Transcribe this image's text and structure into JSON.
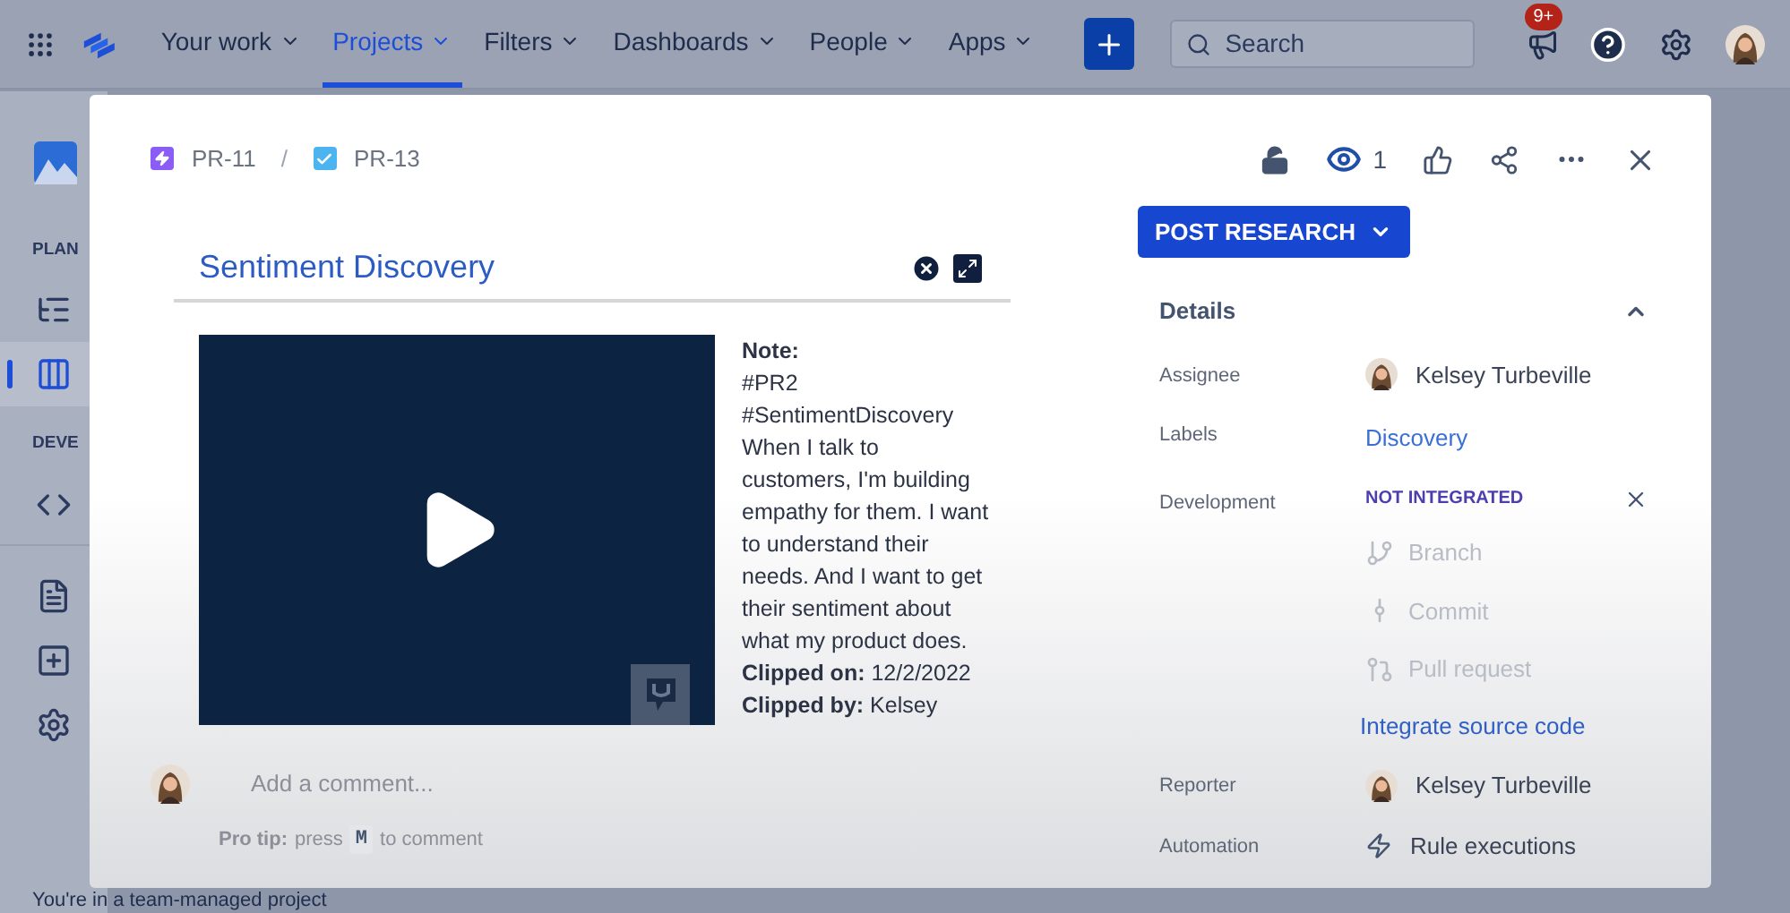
{
  "nav": {
    "items": [
      {
        "label": "Your work",
        "selected": false
      },
      {
        "label": "Projects",
        "selected": true
      },
      {
        "label": "Filters",
        "selected": false
      },
      {
        "label": "Dashboards",
        "selected": false
      },
      {
        "label": "People",
        "selected": false
      },
      {
        "label": "Apps",
        "selected": false
      }
    ],
    "search": {
      "placeholder": "Search"
    },
    "notification_badge": "9+"
  },
  "sidebar": {
    "sections": [
      {
        "label": "PLAN",
        "items": [
          {
            "kind": "roadmap",
            "selected": false
          },
          {
            "kind": "board",
            "selected": true
          }
        ]
      },
      {
        "label": "DEVE",
        "items": [
          {
            "kind": "code",
            "selected": false
          }
        ]
      },
      {
        "items": [
          {
            "kind": "page",
            "selected": false
          },
          {
            "kind": "add",
            "selected": false
          },
          {
            "kind": "settings",
            "selected": false
          }
        ]
      }
    ],
    "footer": "You're in a team-managed project"
  },
  "modal": {
    "breadcrumb_separator": "/",
    "breadcrumb": [
      {
        "key": "PR-11",
        "kind": "epic"
      },
      {
        "key": "PR-13",
        "kind": "task"
      }
    ],
    "watchers": "1",
    "clip": {
      "title": "Sentiment Discovery",
      "note_label": "Note:",
      "note_body": "#PR2  #SentimentDiscovery When I talk to customers, I'm building empathy for them. I want to understand their needs. And I want to get their sentiment about what my product does.",
      "meta": [
        {
          "label": "Clipped on:",
          "value": "12/2/2022"
        },
        {
          "label": "Clipped by:",
          "value": "Kelsey"
        }
      ]
    },
    "comment": {
      "placeholder": "Add a comment..."
    },
    "pro_tip": {
      "label": "Pro tip:",
      "before": "press",
      "key": "M",
      "after": "to comment"
    },
    "status_button": "POST RESEARCH",
    "details": {
      "title": "Details",
      "expanded": true,
      "fields": [
        {
          "label": "Assignee",
          "kind": "user",
          "value": "Kelsey Turbeville"
        },
        {
          "label": "Labels",
          "kind": "link",
          "value": "Discovery"
        },
        {
          "label": "Development",
          "kind": "development",
          "status": "NOT INTEGRATED",
          "items": [
            {
              "kind": "branch",
              "label": "Branch"
            },
            {
              "kind": "commit",
              "label": "Commit"
            },
            {
              "kind": "pull_request",
              "label": "Pull request"
            }
          ],
          "action": "Integrate source code"
        },
        {
          "label": "Reporter",
          "kind": "user",
          "value": "Kelsey Turbeville"
        },
        {
          "label": "Automation",
          "kind": "automation",
          "value": "Rule executions"
        }
      ]
    }
  }
}
